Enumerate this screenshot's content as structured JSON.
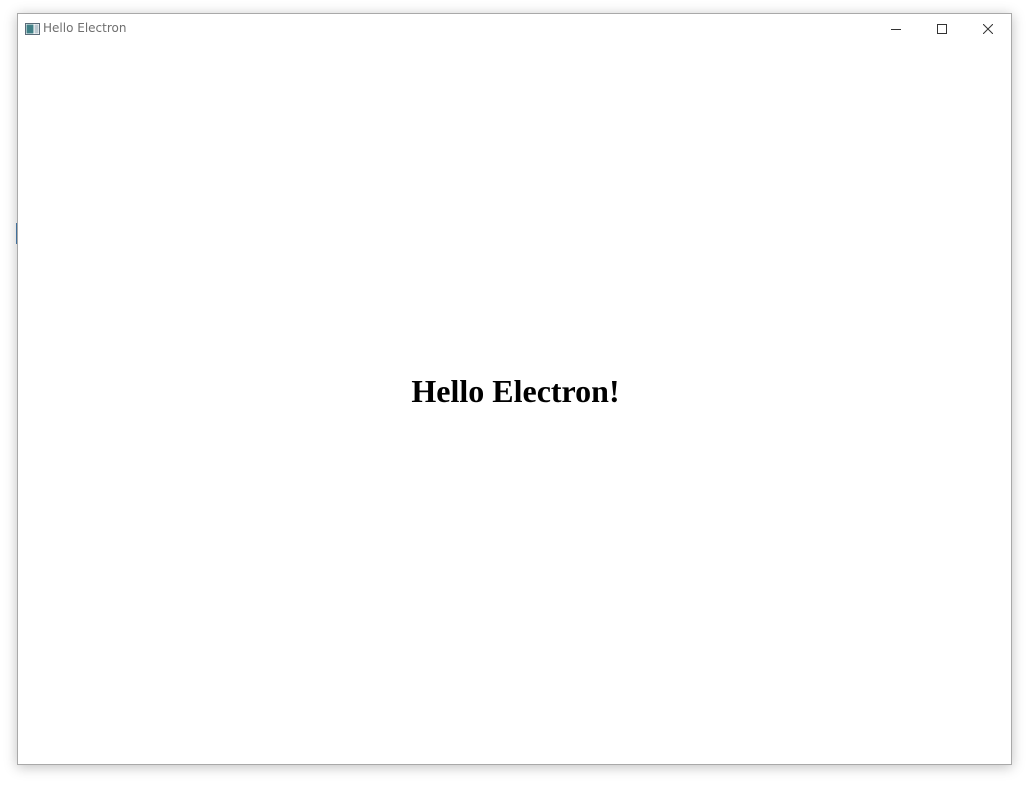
{
  "window": {
    "title": "Hello Electron",
    "icon": "electron-app-icon",
    "controls": {
      "minimize": "minimize-icon",
      "maximize": "maximize-icon",
      "close": "close-icon"
    }
  },
  "content": {
    "heading": "Hello Electron!"
  },
  "colors": {
    "title_text": "#6f6f6f",
    "border": "#a9a9a9",
    "heading_text": "#000000"
  }
}
